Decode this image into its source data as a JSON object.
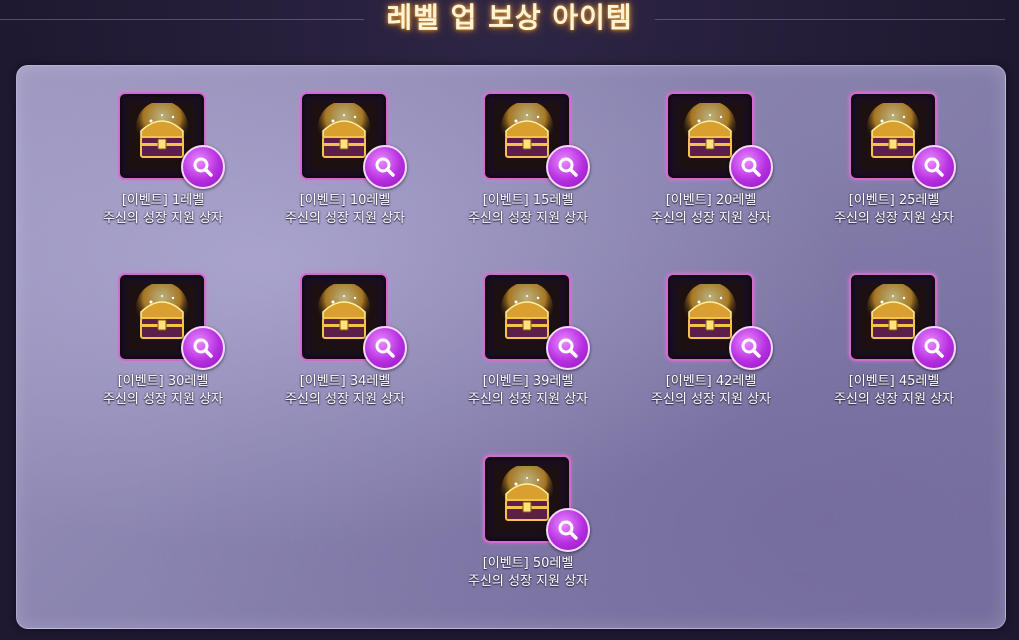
{
  "header": {
    "title": "레벨 업 보상 아이템"
  },
  "items": [
    {
      "line1": "[이벤트] 1레벨",
      "line2": "주신의 성장 지원 상자"
    },
    {
      "line1": "[이벤트] 10레벨",
      "line2": "주신의 성장 지원 상자"
    },
    {
      "line1": "[이벤트] 15레벨",
      "line2": "주신의 성장 지원 상자"
    },
    {
      "line1": "[이벤트] 20레벨",
      "line2": "주신의 성장 지원 상자"
    },
    {
      "line1": "[이벤트] 25레벨",
      "line2": "주신의 성장 지원 상자"
    },
    {
      "line1": "[이벤트] 30레벨",
      "line2": "주신의 성장 지원 상자"
    },
    {
      "line1": "[이벤트] 34레벨",
      "line2": "주신의 성장 지원 상자"
    },
    {
      "line1": "[이벤트] 39레벨",
      "line2": "주신의 성장 지원 상자"
    },
    {
      "line1": "[이벤트] 42레벨",
      "line2": "주신의 성장 지원 상자"
    },
    {
      "line1": "[이벤트] 45레벨",
      "line2": "주신의 성장 지원 상자"
    },
    {
      "line1": "[이벤트] 50레벨",
      "line2": "주신의 성장 지원 상자"
    }
  ],
  "icons": {
    "item_icon": "treasure-chest-icon",
    "zoom_icon": "magnifier-icon"
  },
  "colors": {
    "accent": "#b62ee0",
    "frame_border": "#d26bd0",
    "title": "#fff3d6"
  }
}
